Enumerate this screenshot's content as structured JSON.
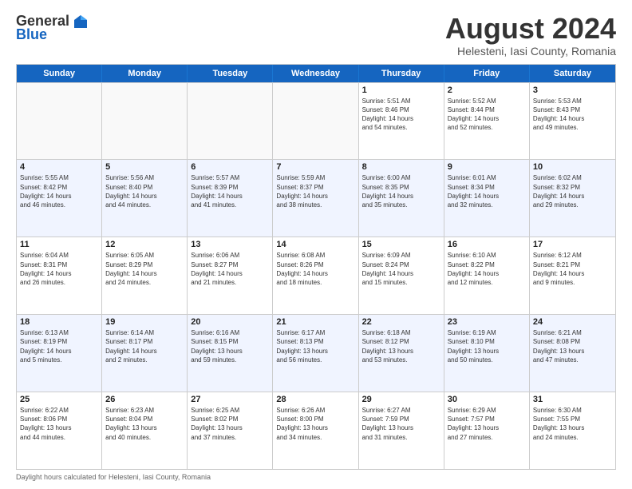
{
  "logo": {
    "general": "General",
    "blue": "Blue"
  },
  "title": "August 2024",
  "subtitle": "Helesteni, Iasi County, Romania",
  "header_days": [
    "Sunday",
    "Monday",
    "Tuesday",
    "Wednesday",
    "Thursday",
    "Friday",
    "Saturday"
  ],
  "rows": [
    [
      {
        "day": "",
        "info": "",
        "empty": true
      },
      {
        "day": "",
        "info": "",
        "empty": true
      },
      {
        "day": "",
        "info": "",
        "empty": true
      },
      {
        "day": "",
        "info": "",
        "empty": true
      },
      {
        "day": "1",
        "info": "Sunrise: 5:51 AM\nSunset: 8:46 PM\nDaylight: 14 hours\nand 54 minutes."
      },
      {
        "day": "2",
        "info": "Sunrise: 5:52 AM\nSunset: 8:44 PM\nDaylight: 14 hours\nand 52 minutes."
      },
      {
        "day": "3",
        "info": "Sunrise: 5:53 AM\nSunset: 8:43 PM\nDaylight: 14 hours\nand 49 minutes."
      }
    ],
    [
      {
        "day": "4",
        "info": "Sunrise: 5:55 AM\nSunset: 8:42 PM\nDaylight: 14 hours\nand 46 minutes."
      },
      {
        "day": "5",
        "info": "Sunrise: 5:56 AM\nSunset: 8:40 PM\nDaylight: 14 hours\nand 44 minutes."
      },
      {
        "day": "6",
        "info": "Sunrise: 5:57 AM\nSunset: 8:39 PM\nDaylight: 14 hours\nand 41 minutes."
      },
      {
        "day": "7",
        "info": "Sunrise: 5:59 AM\nSunset: 8:37 PM\nDaylight: 14 hours\nand 38 minutes."
      },
      {
        "day": "8",
        "info": "Sunrise: 6:00 AM\nSunset: 8:35 PM\nDaylight: 14 hours\nand 35 minutes."
      },
      {
        "day": "9",
        "info": "Sunrise: 6:01 AM\nSunset: 8:34 PM\nDaylight: 14 hours\nand 32 minutes."
      },
      {
        "day": "10",
        "info": "Sunrise: 6:02 AM\nSunset: 8:32 PM\nDaylight: 14 hours\nand 29 minutes."
      }
    ],
    [
      {
        "day": "11",
        "info": "Sunrise: 6:04 AM\nSunset: 8:31 PM\nDaylight: 14 hours\nand 26 minutes."
      },
      {
        "day": "12",
        "info": "Sunrise: 6:05 AM\nSunset: 8:29 PM\nDaylight: 14 hours\nand 24 minutes."
      },
      {
        "day": "13",
        "info": "Sunrise: 6:06 AM\nSunset: 8:27 PM\nDaylight: 14 hours\nand 21 minutes."
      },
      {
        "day": "14",
        "info": "Sunrise: 6:08 AM\nSunset: 8:26 PM\nDaylight: 14 hours\nand 18 minutes."
      },
      {
        "day": "15",
        "info": "Sunrise: 6:09 AM\nSunset: 8:24 PM\nDaylight: 14 hours\nand 15 minutes."
      },
      {
        "day": "16",
        "info": "Sunrise: 6:10 AM\nSunset: 8:22 PM\nDaylight: 14 hours\nand 12 minutes."
      },
      {
        "day": "17",
        "info": "Sunrise: 6:12 AM\nSunset: 8:21 PM\nDaylight: 14 hours\nand 9 minutes."
      }
    ],
    [
      {
        "day": "18",
        "info": "Sunrise: 6:13 AM\nSunset: 8:19 PM\nDaylight: 14 hours\nand 5 minutes."
      },
      {
        "day": "19",
        "info": "Sunrise: 6:14 AM\nSunset: 8:17 PM\nDaylight: 14 hours\nand 2 minutes."
      },
      {
        "day": "20",
        "info": "Sunrise: 6:16 AM\nSunset: 8:15 PM\nDaylight: 13 hours\nand 59 minutes."
      },
      {
        "day": "21",
        "info": "Sunrise: 6:17 AM\nSunset: 8:13 PM\nDaylight: 13 hours\nand 56 minutes."
      },
      {
        "day": "22",
        "info": "Sunrise: 6:18 AM\nSunset: 8:12 PM\nDaylight: 13 hours\nand 53 minutes."
      },
      {
        "day": "23",
        "info": "Sunrise: 6:19 AM\nSunset: 8:10 PM\nDaylight: 13 hours\nand 50 minutes."
      },
      {
        "day": "24",
        "info": "Sunrise: 6:21 AM\nSunset: 8:08 PM\nDaylight: 13 hours\nand 47 minutes."
      }
    ],
    [
      {
        "day": "25",
        "info": "Sunrise: 6:22 AM\nSunset: 8:06 PM\nDaylight: 13 hours\nand 44 minutes."
      },
      {
        "day": "26",
        "info": "Sunrise: 6:23 AM\nSunset: 8:04 PM\nDaylight: 13 hours\nand 40 minutes."
      },
      {
        "day": "27",
        "info": "Sunrise: 6:25 AM\nSunset: 8:02 PM\nDaylight: 13 hours\nand 37 minutes."
      },
      {
        "day": "28",
        "info": "Sunrise: 6:26 AM\nSunset: 8:00 PM\nDaylight: 13 hours\nand 34 minutes."
      },
      {
        "day": "29",
        "info": "Sunrise: 6:27 AM\nSunset: 7:59 PM\nDaylight: 13 hours\nand 31 minutes."
      },
      {
        "day": "30",
        "info": "Sunrise: 6:29 AM\nSunset: 7:57 PM\nDaylight: 13 hours\nand 27 minutes."
      },
      {
        "day": "31",
        "info": "Sunrise: 6:30 AM\nSunset: 7:55 PM\nDaylight: 13 hours\nand 24 minutes."
      }
    ]
  ],
  "footer": "Daylight hours calculated for Helesteni, Iasi County, Romania"
}
